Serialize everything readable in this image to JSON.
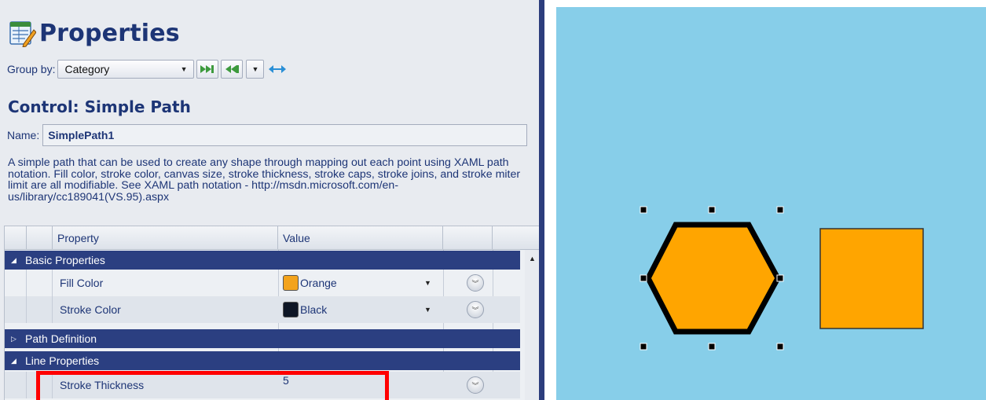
{
  "header": {
    "title": "Properties",
    "icon": "properties-icon"
  },
  "toolbar": {
    "group_by_label": "Group by:",
    "group_by_value": "Category",
    "expand_all_icon": "expand-all-icon",
    "collapse_all_icon": "collapse-all-icon",
    "options_icon": "chevron-down-icon",
    "swap_icon": "horizontal-arrows-icon"
  },
  "control": {
    "title": "Control: Simple Path",
    "name_label": "Name:",
    "name_value": "SimplePath1",
    "description": "A simple path that can be used to create any shape through mapping out each point using XAML path notation. Fill color, stroke color, canvas size, stroke thickness, stroke caps, stroke joins, and stroke miter limit are all modifiable. See XAML path notation - http://msdn.microsoft.com/en-us/library/cc189041(VS.95).aspx"
  },
  "grid": {
    "columns": [
      "Property",
      "Value"
    ],
    "categories": [
      {
        "label": "Basic Properties",
        "expanded": true,
        "rows": [
          {
            "name": "Fill Color",
            "value": "Orange",
            "swatch": "#f3a31c"
          },
          {
            "name": "Stroke Color",
            "value": "Black",
            "swatch": "#0e1626"
          }
        ]
      },
      {
        "label": "Path Definition",
        "expanded": false,
        "rows": []
      },
      {
        "label": "Line Properties",
        "expanded": true,
        "rows": [
          {
            "name": "Stroke Thickness",
            "value": "5"
          }
        ]
      }
    ]
  },
  "canvas": {
    "background": "#87cee9",
    "hexagon": {
      "fill": "#ffa500",
      "stroke": "#000000",
      "selected": true
    },
    "square": {
      "fill": "#ffa500",
      "stroke": "#333333"
    }
  },
  "colors": {
    "accent": "#2b3f81",
    "title_text": "#1d3576",
    "highlight": "#ff0000"
  }
}
